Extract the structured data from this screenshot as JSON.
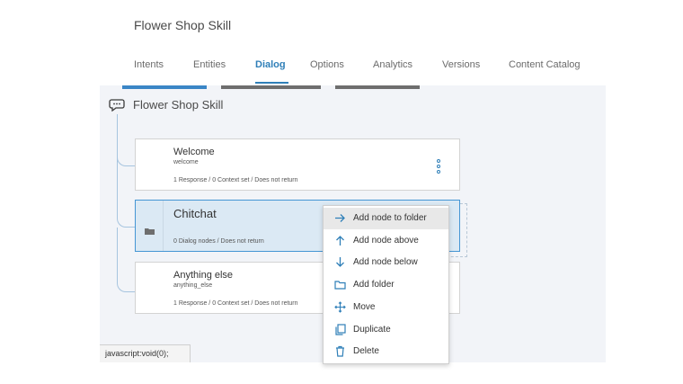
{
  "app": {
    "title": "Flower Shop Skill"
  },
  "tabs": [
    {
      "label": "Intents",
      "active": false
    },
    {
      "label": "Entities",
      "active": false
    },
    {
      "label": "Dialog",
      "active": true
    },
    {
      "label": "Options",
      "active": false
    },
    {
      "label": "Analytics",
      "active": false
    },
    {
      "label": "Versions",
      "active": false
    },
    {
      "label": "Content Catalog",
      "active": false
    }
  ],
  "colors": {
    "accent": "#2f7fb8",
    "selected_node_bg": "#dbe9f4",
    "canvas_bg": "#f2f4f8",
    "tree_line": "#a6c4df"
  },
  "dialog": {
    "skill_name": "Flower Shop Skill",
    "skill_icon": "chat-bubble-icon",
    "nodes": [
      {
        "title": "Welcome",
        "id": "welcome",
        "meta": "1 Response / 0 Context set / Does not return",
        "selected": false,
        "type": "node"
      },
      {
        "title": "Chitchat",
        "id": "",
        "meta": "0 Dialog nodes / Does not return",
        "selected": true,
        "type": "folder"
      },
      {
        "title": "Anything else",
        "id": "anything_else",
        "meta": "1 Response / 0 Context set / Does not return",
        "selected": false,
        "type": "node"
      }
    ]
  },
  "context_menu": {
    "items": [
      {
        "label": "Add node to folder",
        "icon": "arrow-right-icon",
        "hover": true
      },
      {
        "label": "Add node above",
        "icon": "arrow-up-icon",
        "hover": false
      },
      {
        "label": "Add node below",
        "icon": "arrow-down-icon",
        "hover": false
      },
      {
        "label": "Add folder",
        "icon": "folder-icon",
        "hover": false
      },
      {
        "label": "Move",
        "icon": "move-icon",
        "hover": false
      },
      {
        "label": "Duplicate",
        "icon": "duplicate-icon",
        "hover": false
      },
      {
        "label": "Delete",
        "icon": "trash-icon",
        "hover": false
      }
    ]
  },
  "status_bar": {
    "text": "javascript:void(0);"
  }
}
